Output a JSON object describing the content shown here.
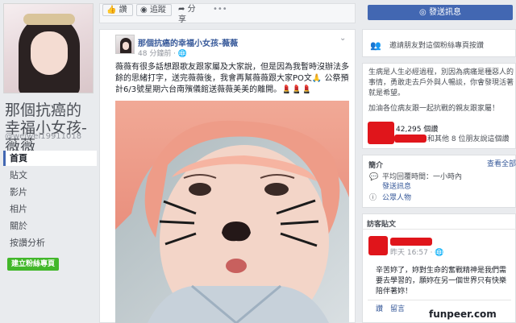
{
  "sidebar": {
    "page_name": "那個抗癌的幸福小女孩-薇薇",
    "handle": "@weiwei19911018",
    "nav": [
      {
        "label": "首頁",
        "active": true
      },
      {
        "label": "貼文",
        "active": false
      },
      {
        "label": "影片",
        "active": false
      },
      {
        "label": "相片",
        "active": false
      },
      {
        "label": "關於",
        "active": false
      },
      {
        "label": "按讚分析",
        "active": false
      }
    ],
    "create_button": "建立粉絲專頁"
  },
  "actions": {
    "like": "讚",
    "follow": "追蹤",
    "share": "分享",
    "more": "•••",
    "message": "發送訊息"
  },
  "post": {
    "author": "那個抗癌的幸福小女孩-薇薇",
    "time": "48 分鐘前 · ",
    "text": "薇薇有很多話想跟歌友跟家屬及大家說，但是因為我暫時沒辦法多餘的思緒打字，送完薇薇後，我會再幫薇薇跟大家PO文🙏 公祭預計6/3號星期六台南殯儀館送薇薇美美的離開。💄💄💄"
  },
  "right": {
    "invite": "邀請朋友對這個粉絲專頁按讚",
    "about_lines": [
      "生病是人生必經過程，別因為病痛是種惡人的事情，勇敢走去戶外與人暢談，你會發現活著就是希望。",
      "加油各位病友跟一起抗戰的親友跟家屬！"
    ],
    "likes_count": "42,295 個讚",
    "likes_suffix": "和其他 8 位朋友說這個讚",
    "info_title": "簡介",
    "see_all": "查看全部",
    "response": "平均回覆時間：一小時內",
    "send_message": "發送訊息",
    "category": "公眾人物",
    "visitor_title": "訪客貼文",
    "visitor_time": "昨天 16:57 · ",
    "visitor_text": "辛苦妳了，妳對生命的奮戰精神是我們需要去學習的，願妳在另一個世界只有快樂陪伴著妳！",
    "visitor_actions": [
      "讚",
      "留言"
    ]
  },
  "watermark": "funpeer.com"
}
